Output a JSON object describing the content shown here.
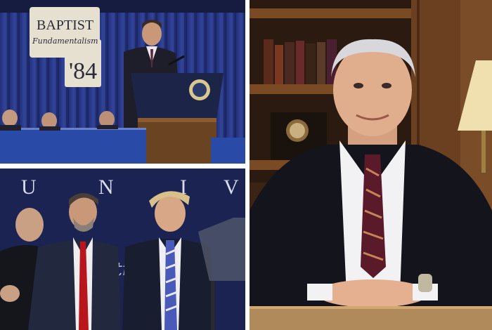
{
  "panels": [
    {
      "id": "top-left",
      "sign_lines": [
        "BAPTIST",
        "Fundamentalism",
        "'84"
      ],
      "description_visible": "speaker-at-podium"
    },
    {
      "id": "bottom-left",
      "backdrop_letters": [
        "U",
        "N",
        "I",
        "V"
      ],
      "backdrop_script_fragment": "ati"
    },
    {
      "id": "right",
      "description_visible": "seated-portrait-with-bookshelf"
    }
  ],
  "colors": {
    "curtain_blue": "#2b3a8c",
    "podium_navy": "#1c2448",
    "backdrop_navy": "#1a2352",
    "wood_shelf": "#5a3418",
    "suit_dark": "#14141c",
    "tie_red": "#b8151c"
  }
}
